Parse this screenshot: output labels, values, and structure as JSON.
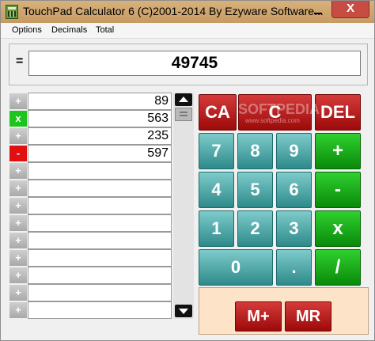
{
  "window": {
    "title": "TouchPad Calculator 6 (C)2001-2014 By Ezyware Software...",
    "minimize_label": "",
    "close_label": "X"
  },
  "menu": {
    "items": [
      {
        "label": "Options"
      },
      {
        "label": "Decimals"
      },
      {
        "label": "Total"
      }
    ]
  },
  "result": {
    "eq_label": "=",
    "value": "49745"
  },
  "tape": {
    "rows": [
      {
        "op": "+",
        "value": "89",
        "op_color": "gray"
      },
      {
        "op": "x",
        "value": "563",
        "op_color": "green"
      },
      {
        "op": "+",
        "value": "235",
        "op_color": "gray"
      },
      {
        "op": "-",
        "value": "597",
        "op_color": "red"
      },
      {
        "op": "+",
        "value": "",
        "op_color": "gray"
      },
      {
        "op": "+",
        "value": "",
        "op_color": "gray"
      },
      {
        "op": "+",
        "value": "",
        "op_color": "gray"
      },
      {
        "op": "+",
        "value": "",
        "op_color": "gray"
      },
      {
        "op": "+",
        "value": "",
        "op_color": "gray"
      },
      {
        "op": "+",
        "value": "",
        "op_color": "gray"
      },
      {
        "op": "+",
        "value": "",
        "op_color": "gray"
      },
      {
        "op": "+",
        "value": "",
        "op_color": "gray"
      },
      {
        "op": "+",
        "value": "",
        "op_color": "gray"
      }
    ]
  },
  "keypad": {
    "ca": "CA",
    "c": "C",
    "del": "DEL",
    "n7": "7",
    "n8": "8",
    "n9": "9",
    "n4": "4",
    "n5": "5",
    "n6": "6",
    "n1": "1",
    "n2": "2",
    "n3": "3",
    "n0": "0",
    "dot": ".",
    "plus": "+",
    "minus": "-",
    "times": "x",
    "divide": "/",
    "m_plus": "M+",
    "mr": "MR"
  },
  "watermark": {
    "text": "SOFTPEDIA",
    "sub": "www.softpedia.com"
  },
  "colors": {
    "title_bar": "#c79a63",
    "numeric_key": "#2e8a8a",
    "operator_key": "#0a8a0a",
    "clear_key": "#9c0a0a",
    "memory_panel": "#fde4c8"
  }
}
